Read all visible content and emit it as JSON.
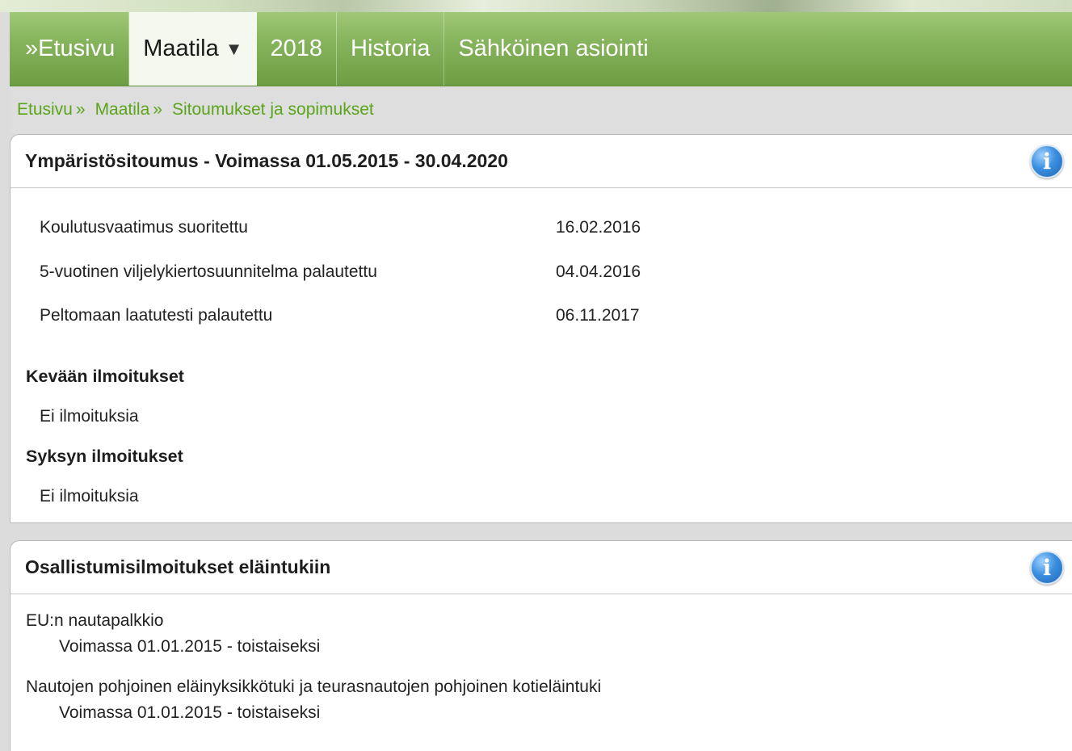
{
  "nav": {
    "items": [
      {
        "label": "»Etusivu"
      },
      {
        "label": "Maatila",
        "caret": "▼"
      },
      {
        "label": "2018"
      },
      {
        "label": "Historia"
      },
      {
        "label": "Sähköinen asiointi"
      }
    ]
  },
  "breadcrumb": {
    "items": [
      "Etusivu",
      "Maatila",
      "Sitoumukset ja sopimukset"
    ],
    "separator": "»"
  },
  "panel1": {
    "title": "Ympäristösitoumus - Voimassa 01.05.2015 - 30.04.2020",
    "rows": [
      {
        "label": "Koulutusvaatimus suoritettu",
        "value": "16.02.2016"
      },
      {
        "label": "5-vuotinen viljelykiertosuunnitelma palautettu",
        "value": "04.04.2016"
      },
      {
        "label": "Peltomaan laatutesti palautettu",
        "value": "06.11.2017"
      }
    ],
    "spring_title": "Kevään ilmoitukset",
    "spring_text": "Ei ilmoituksia",
    "autumn_title": "Syksyn ilmoitukset",
    "autumn_text": "Ei ilmoituksia"
  },
  "panel2": {
    "title": "Osallistumisilmoitukset eläintukiin",
    "items": [
      {
        "name": "EU:n nautapalkkio",
        "validity": "Voimassa 01.01.2015 - toistaiseksi"
      },
      {
        "name": "Nautojen pohjoinen eläinyksikkötuki ja teurasnautojen pohjoinen kotieläintuki",
        "validity": "Voimassa 01.01.2015 - toistaiseksi"
      }
    ]
  },
  "icons": {
    "info": "info-icon",
    "dropdown": "chevron-down-icon"
  },
  "colors": {
    "nav_green": "#86b45c",
    "link_green": "#5aa51a",
    "info_blue": "#3b8fe0"
  }
}
